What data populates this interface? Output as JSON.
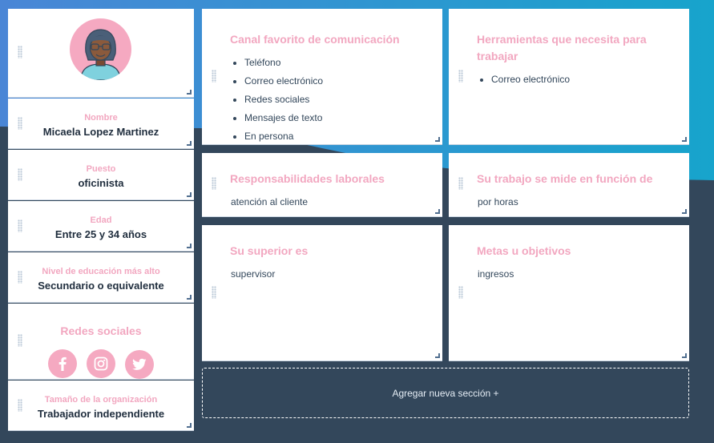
{
  "colors": {
    "accent_pink": "#f2a7c0",
    "navy": "#33475b",
    "sky_top": "#4a86d6",
    "sky_right": "#1aa3cc"
  },
  "persona": {
    "avatar_icon": "woman-avatar-icon",
    "fields": [
      {
        "label": "Nombre",
        "value": "Micaela Lopez  Martinez"
      },
      {
        "label": "Puesto",
        "value": "oficinista"
      },
      {
        "label": "Edad",
        "value": "Entre 25 y 34 años"
      },
      {
        "label": "Nivel de educación más alto",
        "value": "Secundario o equivalente"
      }
    ],
    "social": {
      "label": "Redes sociales",
      "icons": [
        "facebook-icon",
        "instagram-icon",
        "twitter-icon"
      ]
    },
    "org_size": {
      "label": "Tamaño de la organización",
      "value": "Trabajador independiente"
    }
  },
  "sections": {
    "channel": {
      "title": "Canal favorito de comunicación",
      "items": [
        "Teléfono",
        "Correo electrónico",
        "Redes sociales",
        "Mensajes de texto",
        "En persona"
      ]
    },
    "tools": {
      "title": "Herramientas que necesita para trabajar",
      "items": [
        "Correo electrónico"
      ]
    },
    "responsibilities": {
      "title": "Responsabilidades laborales",
      "text": "atención al cliente"
    },
    "measured": {
      "title": "Su trabajo se mide en función de",
      "text": "por horas"
    },
    "superior": {
      "title": "Su superior es",
      "text": "supervisor"
    },
    "goals": {
      "title": "Metas u objetivos",
      "text": "ingresos"
    }
  },
  "add_section_label": "Agregar nueva sección +"
}
